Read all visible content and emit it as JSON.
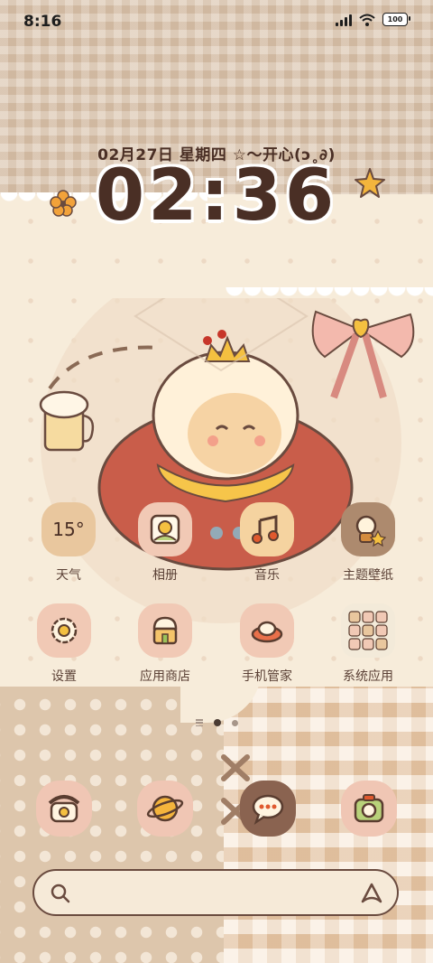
{
  "status_bar": {
    "time": "8:16",
    "battery": "100",
    "icons": [
      "signal-icon",
      "wifi-icon",
      "battery-icon"
    ]
  },
  "clock_widget": {
    "date_line": "02月27日 星期四  ☆～开心(ↄ˳∂)",
    "time": "02:36"
  },
  "apps": [
    {
      "id": "weather",
      "label": "天气",
      "value": "15°",
      "icon": "weather-icon"
    },
    {
      "id": "gallery",
      "label": "相册",
      "icon": "gallery-icon"
    },
    {
      "id": "music",
      "label": "音乐",
      "icon": "music-icon"
    },
    {
      "id": "themes",
      "label": "主题壁纸",
      "icon": "themes-icon"
    },
    {
      "id": "settings",
      "label": "设置",
      "icon": "settings-icon"
    },
    {
      "id": "app-store",
      "label": "应用商店",
      "icon": "app-store-icon"
    },
    {
      "id": "phone-manager",
      "label": "手机管家",
      "icon": "phone-manager-icon"
    },
    {
      "id": "system-apps",
      "label": "系统应用",
      "icon": "folder-icon"
    }
  ],
  "pages": {
    "count": 2,
    "current": 1
  },
  "dock": [
    {
      "id": "phone",
      "icon": "phone-icon"
    },
    {
      "id": "browser",
      "icon": "browser-icon"
    },
    {
      "id": "messages",
      "icon": "messages-icon"
    },
    {
      "id": "camera",
      "icon": "camera-icon"
    }
  ],
  "search_bar": {
    "icons": [
      "search-icon",
      "assistant-icon"
    ]
  },
  "colors": {
    "text_dark": "#4a2f25",
    "label": "#5b4136",
    "icon_bg": "#f1c9b5",
    "background": "#f7ecda"
  }
}
